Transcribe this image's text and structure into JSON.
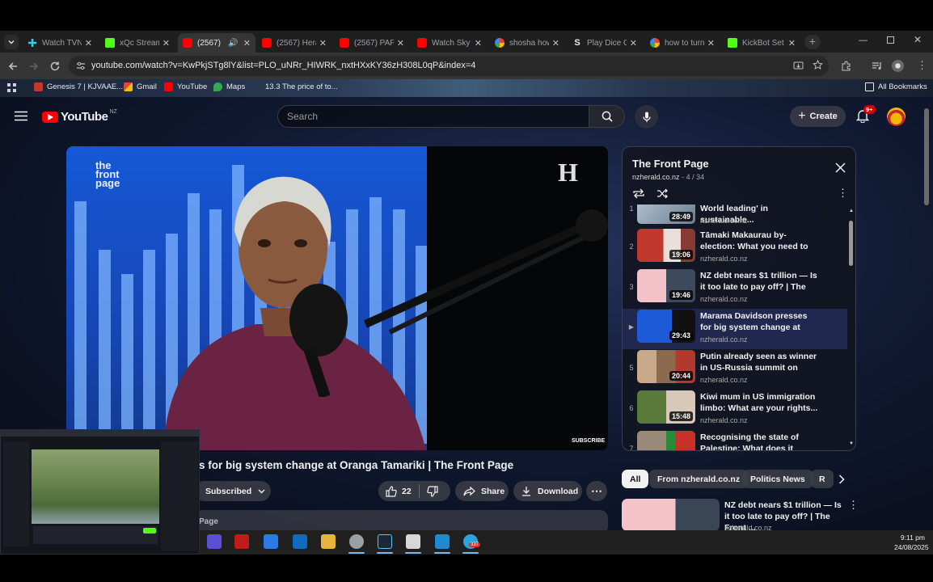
{
  "browser": {
    "tabs": [
      {
        "title": "Watch TVN",
        "active": false,
        "icon": "plus-icon"
      },
      {
        "title": "xQc Stream",
        "active": false,
        "icon": "kick-icon"
      },
      {
        "title": "(2567)",
        "active": true,
        "icon": "youtube-icon"
      },
      {
        "title": "(2567) Hera",
        "active": false,
        "icon": "youtube-icon"
      },
      {
        "title": "(2567) PAP",
        "active": false,
        "icon": "youtube-icon"
      },
      {
        "title": "Watch Sky",
        "active": false,
        "icon": "youtube-icon"
      },
      {
        "title": "shosha how",
        "active": false,
        "icon": "google-icon"
      },
      {
        "title": "Play Dice C",
        "active": false,
        "icon": "stake-icon"
      },
      {
        "title": "how to turn",
        "active": false,
        "icon": "google-icon"
      },
      {
        "title": "KickBot Set",
        "active": false,
        "icon": "kick-icon"
      }
    ],
    "url": "youtube.com/watch?v=KwPkjSTg8lY&list=PLO_uNRr_HIWRK_nxtHXxKY36zH308L0qP&index=4",
    "bookmarks": [
      "Genesis 7 | KJVAAE...",
      "Gmail",
      "YouTube",
      "Maps",
      "13.3 The price of to..."
    ],
    "all_bookmarks": "All Bookmarks"
  },
  "youtube": {
    "logo_text": "YouTube",
    "region": "NZ",
    "search_placeholder": "Search",
    "create_label": "Create",
    "notif_count": "9+",
    "video": {
      "brand_text": "the front page",
      "herald_mark": "H",
      "subscribe_overlay": "SUBSCRIBE",
      "title_partial": "s for big system change at Oranga Tamariki | The Front Page",
      "subscribed_label": "Subscribed",
      "likes": "22",
      "share_label": "Share",
      "download_label": "Download",
      "desc_partial": "Page"
    },
    "playlist": {
      "title": "The Front Page",
      "channel": "nzherald.co.nz",
      "position": "4 / 34",
      "items": [
        {
          "index": "1",
          "title": "World leading' in sustainable...",
          "duration": "28:49",
          "channel": "nzherald.co.nz",
          "current": false
        },
        {
          "index": "2",
          "title": "Tāmaki Makaurau by-election: What you need to know | The...",
          "duration": "19:06",
          "channel": "nzherald.co.nz",
          "current": false
        },
        {
          "index": "3",
          "title": "NZ debt nears $1 trillion — Is it too late to pay off? | The Front...",
          "duration": "19:46",
          "channel": "nzherald.co.nz",
          "current": false
        },
        {
          "index": "▶",
          "title": "Marama Davidson presses for big system change at Oranga...",
          "duration": "29:43",
          "channel": "nzherald.co.nz",
          "current": true
        },
        {
          "index": "5",
          "title": "Putin already seen as winner in US-Russia summit on peace i...",
          "duration": "20:44",
          "channel": "nzherald.co.nz",
          "current": false
        },
        {
          "index": "6",
          "title": "Kiwi mum in US immigration limbo: What are your rights...",
          "duration": "15:48",
          "channel": "nzherald.co.nz",
          "current": false
        },
        {
          "index": "7",
          "title": "Recognising the state of Palestine: What does it actual...",
          "duration": "",
          "channel": "nzherald.co.nz",
          "current": false
        }
      ]
    },
    "chips": [
      "All",
      "From nzherald.co.nz",
      "Politics News",
      "R"
    ],
    "related": {
      "title": "NZ debt nears $1 trillion — Is it too late to pay off? | The Front ...",
      "channel": "nzherald.co.nz"
    }
  },
  "taskbar": {
    "time": "9:11 pm",
    "date": "24/08/2025",
    "badge": "337"
  },
  "colors": {
    "yt_red": "#ff0000",
    "accent_blue": "#2f63e6"
  }
}
